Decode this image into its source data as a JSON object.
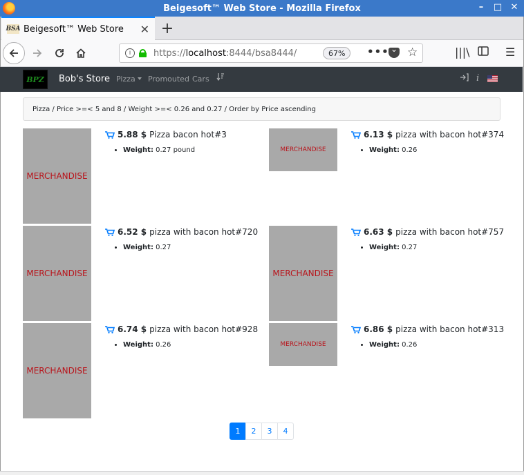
{
  "window": {
    "title": "Beigesoft™ Web Store - Mozilla Firefox"
  },
  "tab": {
    "favicon_text": "BSA",
    "title": "Beigesoft™ Web Store",
    "close": "✕",
    "new_tab": "+"
  },
  "address_bar": {
    "url_scheme": "https://",
    "url_host": "localhost",
    "url_rest": ":8444/bsa8444/",
    "zoom": "67%",
    "more": "•••"
  },
  "site": {
    "logo_text": "BPZ",
    "brand": "Bob's Store",
    "menu": {
      "pizza": "Pizza",
      "promouted": "Promouted",
      "cars": "Cars"
    }
  },
  "breadcrumb": "Pizza / Price >=< 5 and 8 / Weight >=< 0.26 and 0.27 / Order by Price ascending",
  "products": [
    {
      "image_label": "MERCHANDISE",
      "price": "5.88 $",
      "name": "Pizza bacon hot#3",
      "weight_label": "Weight:",
      "weight": "0.27 pound"
    },
    {
      "image_label": "MERCHANDISE",
      "price": "6.13 $",
      "name": "pizza with bacon hot#374",
      "weight_label": "Weight:",
      "weight": "0.26"
    },
    {
      "image_label": "MERCHANDISE",
      "price": "6.52 $",
      "name": "pizza with bacon hot#720",
      "weight_label": "Weight:",
      "weight": "0.27"
    },
    {
      "image_label": "MERCHANDISE",
      "price": "6.63 $",
      "name": "pizza with bacon hot#757",
      "weight_label": "Weight:",
      "weight": "0.27"
    },
    {
      "image_label": "MERCHANDISE",
      "price": "6.74 $",
      "name": "pizza with bacon hot#928",
      "weight_label": "Weight:",
      "weight": "0.26"
    },
    {
      "image_label": "MERCHANDISE",
      "price": "6.86 $",
      "name": "pizza with bacon hot#313",
      "weight_label": "Weight:",
      "weight": "0.26"
    }
  ],
  "pagination": {
    "pages": [
      "1",
      "2",
      "3",
      "4"
    ],
    "current": "1"
  },
  "colors": {
    "nav_bg": "#343a40",
    "accent": "#007bff",
    "placeholder_bg": "#a9a9a9",
    "placeholder_text": "#b8141b",
    "title_bar": "#3b79c9"
  }
}
